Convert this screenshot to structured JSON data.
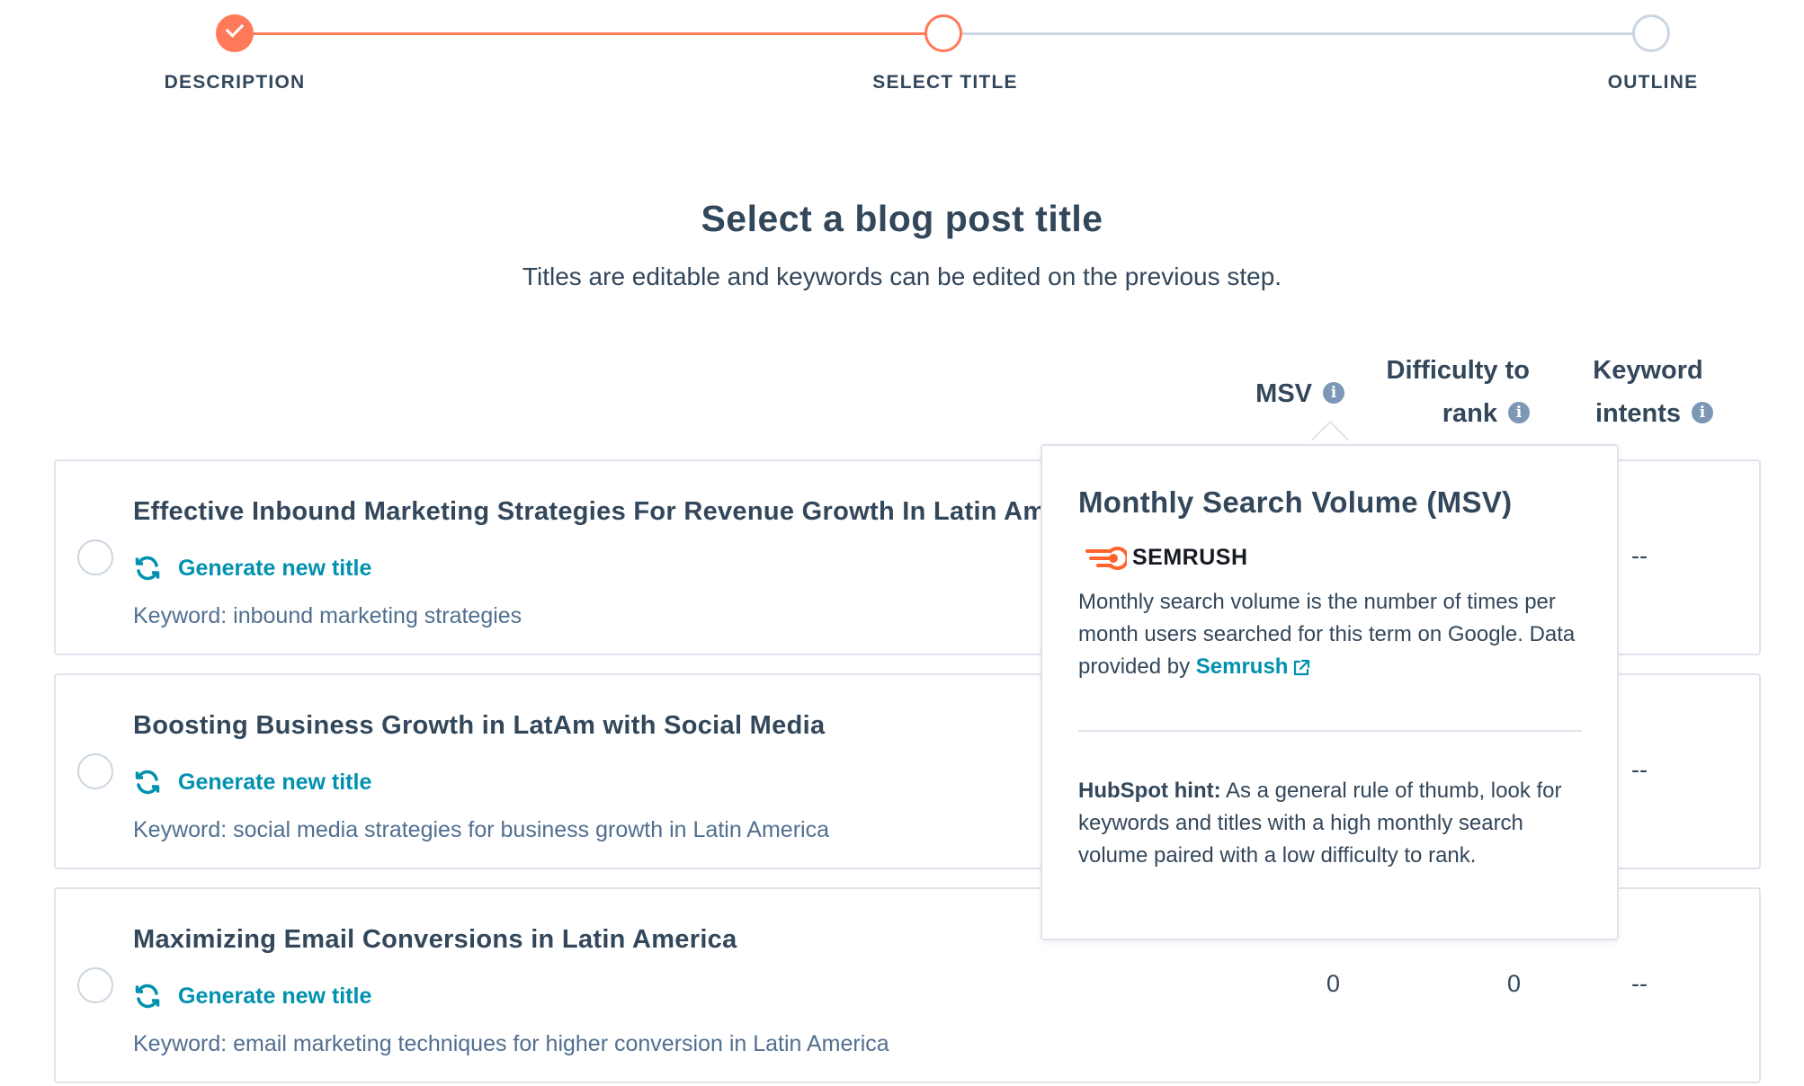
{
  "stepper": {
    "steps": [
      {
        "label": "DESCRIPTION",
        "state": "complete"
      },
      {
        "label": "SELECT TITLE",
        "state": "active"
      },
      {
        "label": "OUTLINE",
        "state": "pending"
      }
    ]
  },
  "header": {
    "title": "Select a blog post title",
    "subtitle": "Titles are editable and keywords can be edited on the previous step."
  },
  "columns": {
    "msv": "MSV",
    "difficulty_line1": "Difficulty to",
    "difficulty_line2": "rank",
    "intents_line1": "Keyword",
    "intents_line2": "intents"
  },
  "titles": [
    {
      "title": "Effective Inbound Marketing Strategies For Revenue Growth In Latin America",
      "generate_label": "Generate new title",
      "keyword": "Keyword: inbound marketing strategies",
      "msv": "",
      "difficulty": "",
      "intents": "--"
    },
    {
      "title": "Boosting Business Growth in LatAm with Social Media",
      "generate_label": "Generate new title",
      "keyword": "Keyword: social media strategies for business growth in Latin America",
      "msv": "",
      "difficulty": "",
      "intents": "--"
    },
    {
      "title": "Maximizing Email Conversions in Latin America",
      "generate_label": "Generate new title",
      "keyword": "Keyword: email marketing techniques for higher conversion in Latin America",
      "msv": "0",
      "difficulty": "0",
      "intents": "--"
    }
  ],
  "tooltip": {
    "title": "Monthly Search Volume (MSV)",
    "logo_text": "SEMRUSH",
    "body": "Monthly search volume is the number of times per month users searched for this term on Google. Data provided by ",
    "link": "Semrush",
    "hint_label": "HubSpot hint:",
    "hint": " As a general rule of thumb, look for keywords and titles with a high monthly search volume paired with a low difficulty to rank."
  },
  "colors": {
    "accent": "#ff7a59",
    "link": "#0091ae",
    "text": "#33475b",
    "border": "#dfe3eb",
    "pending": "#cbd6e2"
  },
  "icons": [
    "check-icon",
    "info-icon",
    "refresh-icon",
    "semrush-logo-icon",
    "external-link-icon"
  ]
}
